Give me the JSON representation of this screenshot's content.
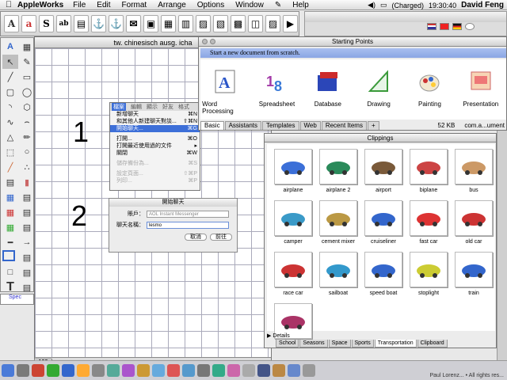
{
  "menubar": {
    "apple": "",
    "app_name": "AppleWorks",
    "items": [
      "File",
      "Edit",
      "Format",
      "Arrange",
      "Options",
      "Window",
      "Help"
    ],
    "status": {
      "battery": "(Charged)",
      "time": "19:30:40",
      "user": "David Feng"
    }
  },
  "document": {
    "title": "tw. chinesisch ausg. icha",
    "zoom": "100",
    "side_prompt": "Spec",
    "labels": {
      "one": "1",
      "two": "2"
    }
  },
  "popup_menu": {
    "bar": [
      "檔案",
      "編輯",
      "顯示",
      "好友",
      "格式"
    ],
    "items": [
      {
        "label": "新增聊天",
        "shortcut": "⌘N",
        "state": "normal"
      },
      {
        "label": "和其他人新建聊天對談...",
        "shortcut": "⇧⌘N",
        "state": "normal"
      },
      {
        "label": "開始聊天...",
        "shortcut": "⌘G",
        "state": "highlighted"
      },
      {
        "label": "",
        "shortcut": "",
        "state": "sep"
      },
      {
        "label": "打開...",
        "shortcut": "⌘O",
        "state": "normal"
      },
      {
        "label": "打開最近使用過的文件",
        "shortcut": "▸",
        "state": "normal"
      },
      {
        "label": "關閉",
        "shortcut": "⌘W",
        "state": "normal"
      },
      {
        "label": "",
        "shortcut": "",
        "state": "sep"
      },
      {
        "label": "儲存備份為...",
        "shortcut": "⌘S",
        "state": "disabled"
      },
      {
        "label": "",
        "shortcut": "",
        "state": "sep"
      },
      {
        "label": "設定頁面...",
        "shortcut": "⇧⌘P",
        "state": "disabled"
      },
      {
        "label": "列印...",
        "shortcut": "⌘P",
        "state": "disabled"
      }
    ]
  },
  "chat_dialog": {
    "title": "開始聊天",
    "account_label": "賬戶：",
    "account_value": "AOL Instant Messenger",
    "name_label": "聊天名稱：",
    "name_value": "lesmo",
    "cancel": "取消",
    "go": "前往"
  },
  "starting_points": {
    "title": "Starting Points",
    "banner": "Start a new document from scratch.",
    "items": [
      "Word Processing",
      "Spreadsheet",
      "Database",
      "Drawing",
      "Painting",
      "Presentation"
    ],
    "tabs": [
      "Basic",
      "Assistants",
      "Templates",
      "Web",
      "Recent Items",
      "+"
    ],
    "active_tab": "Basic",
    "extra": {
      "size": "52 KB",
      "name": "com.a...ument"
    }
  },
  "clippings": {
    "title": "Clippings",
    "items": [
      "airplane",
      "airplane 2",
      "airport",
      "biplane",
      "bus",
      "camper",
      "cement mixer",
      "cruiseliner",
      "fast car",
      "old car",
      "race car",
      "sailboat",
      "speed boat",
      "stoplight",
      "train",
      ""
    ],
    "details": "Details",
    "tabs": [
      "School",
      "Seasons",
      "Space",
      "Sports",
      "Transportation",
      "Clipboard"
    ],
    "active_tab": "Transportation"
  },
  "dock": {
    "text": "Paul Lorenz... • All rights res..."
  },
  "colors": {
    "menu_highlight": "#3d6fd8",
    "banner": "#9db5ec"
  }
}
